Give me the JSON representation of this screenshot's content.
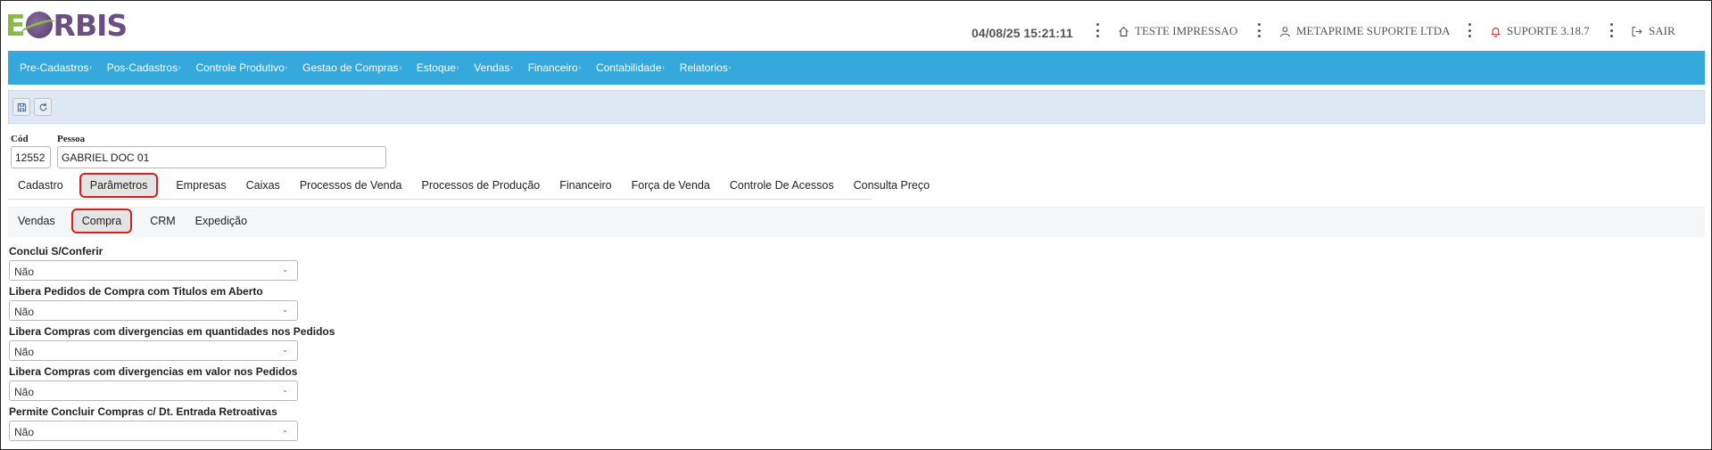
{
  "header": {
    "logo_e": "E",
    "logo_rest": "RBIS",
    "datetime": "04/08/25 15:21:11",
    "store": "TESTE IMPRESSAO",
    "company": "METAPRIME SUPORTE LTDA",
    "support": "SUPORTE 3.18.7",
    "logout": "SAIR"
  },
  "menu": [
    {
      "label": "Pre-Cadastros"
    },
    {
      "label": "Pos-Cadastros"
    },
    {
      "label": "Controle Produtivo"
    },
    {
      "label": "Gestao de Compras"
    },
    {
      "label": "Estoque"
    },
    {
      "label": "Vendas"
    },
    {
      "label": "Financeiro"
    },
    {
      "label": "Contabilidade"
    },
    {
      "label": "Relatorios"
    }
  ],
  "record": {
    "cod_label": "Cód",
    "cod_value": "12552",
    "pessoa_label": "Pessoa",
    "pessoa_value": "GABRIEL DOC 01"
  },
  "tabs": [
    "Cadastro",
    "Parâmetros",
    "Empresas",
    "Caixas",
    "Processos de Venda",
    "Processos de Produção",
    "Financeiro",
    "Força de Venda",
    "Controle De Acessos",
    "Consulta Preço"
  ],
  "subtabs": [
    "Vendas",
    "Compra",
    "CRM",
    "Expedição"
  ],
  "fields": [
    {
      "label": "Conclui S/Conferir",
      "value": "Não"
    },
    {
      "label": "Libera Pedidos de Compra com Titulos em Aberto",
      "value": "Não"
    },
    {
      "label": "Libera Compras com divergencias em quantidades nos Pedidos",
      "value": "Não"
    },
    {
      "label": "Libera Compras com divergencias em valor nos Pedidos",
      "value": "Não"
    },
    {
      "label": "Permite Concluir Compras c/ Dt. Entrada Retroativas",
      "value": "Não"
    }
  ],
  "colors": {
    "menubar": "#35a8dc",
    "toolbar": "#dde8f2",
    "highlight": "#d61e1e",
    "logo_green": "#8bb84a",
    "logo_purple": "#6b4f84"
  }
}
